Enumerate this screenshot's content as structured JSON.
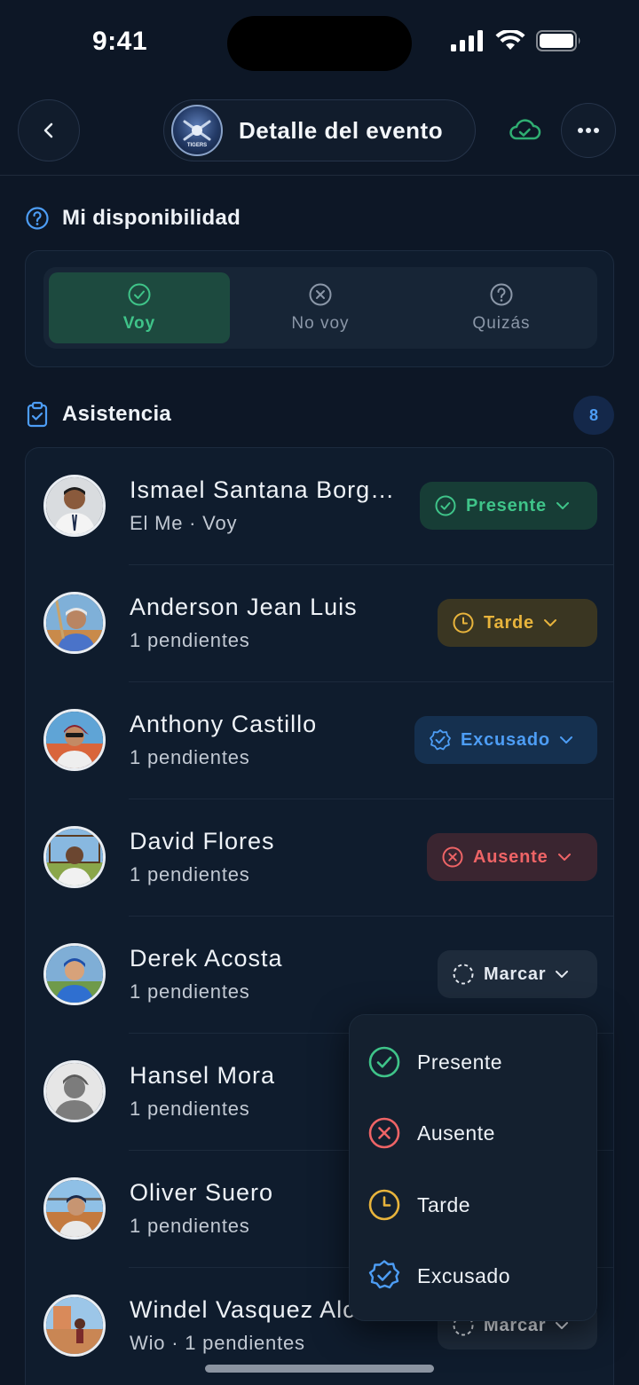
{
  "status_bar": {
    "time": "9:41"
  },
  "nav": {
    "title": "Detalle del evento",
    "team_logo_text": "TIGERS"
  },
  "availability": {
    "title": "Mi disponibilidad",
    "options": [
      {
        "label": "Voy",
        "icon": "check-circle-icon",
        "active": true
      },
      {
        "label": "No voy",
        "icon": "x-circle-icon",
        "active": false
      },
      {
        "label": "Quizás",
        "icon": "question-circle-icon",
        "active": false
      }
    ]
  },
  "attendance": {
    "title": "Asistencia",
    "count": "8",
    "players": [
      {
        "name": "Ismael Santana Borg…",
        "sub": "El Me · Voy",
        "status": "Presente",
        "status_type": "presente"
      },
      {
        "name": "Anderson Jean Luis",
        "sub": "1 pendientes",
        "status": "Tarde",
        "status_type": "tarde"
      },
      {
        "name": "Anthony Castillo",
        "sub": "1 pendientes",
        "status": "Excusado",
        "status_type": "excusado"
      },
      {
        "name": "David Flores",
        "sub": "1 pendientes",
        "status": "Ausente",
        "status_type": "ausente"
      },
      {
        "name": "Derek Acosta",
        "sub": "1 pendientes",
        "status": "Marcar",
        "status_type": "marcar"
      },
      {
        "name": "Hansel Mora",
        "sub": "1 pendientes",
        "status": "",
        "status_type": "none"
      },
      {
        "name": "Oliver Suero",
        "sub": "1 pendientes",
        "status": "",
        "status_type": "none"
      },
      {
        "name": "Windel Vasquez Alc",
        "sub": "Wio · 1 pendientes",
        "status": "Marcar",
        "status_type": "marcar"
      }
    ]
  },
  "dropdown": {
    "items": [
      {
        "label": "Presente",
        "icon": "check-circle-icon",
        "color": "#3fc489"
      },
      {
        "label": "Ausente",
        "icon": "x-circle-icon",
        "color": "#ee6466"
      },
      {
        "label": "Tarde",
        "icon": "clock-icon",
        "color": "#e8b43c"
      },
      {
        "label": "Excusado",
        "icon": "badge-check-icon",
        "color": "#4d9df5"
      }
    ]
  },
  "colors": {
    "background": "#0d1726",
    "card": "#0f1c2d",
    "green": "#3fc489",
    "yellow": "#e8b43c",
    "blue": "#4d9df5",
    "red": "#ee6466"
  }
}
